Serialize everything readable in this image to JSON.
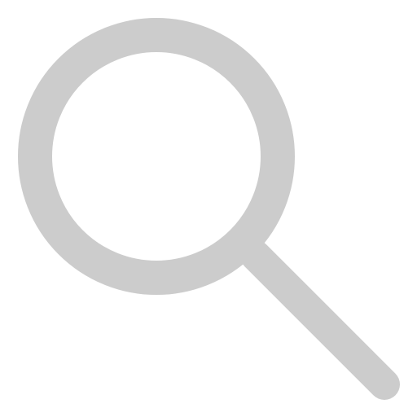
{
  "icon": {
    "name": "search-icon",
    "color": "#cccccc"
  },
  "background": {
    "color": "#ffffff"
  }
}
